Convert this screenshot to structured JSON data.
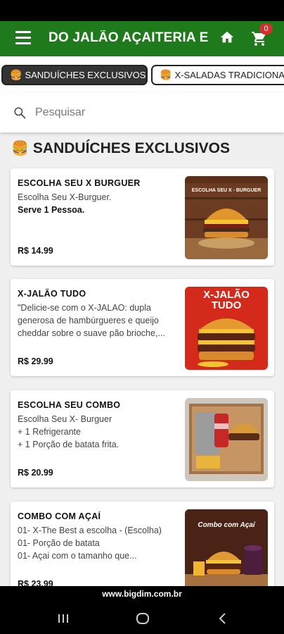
{
  "app_bar": {
    "title": "DO JALÃO AÇAITERIA E",
    "menu_icon": "menu-icon",
    "home_icon": "home-icon",
    "cart_icon": "cart-icon",
    "cart_count": "0",
    "color": "#1e7a1a"
  },
  "tabs": [
    {
      "icon": "🍔",
      "label": "SANDUÍCHES EXCLUSIVOS",
      "active": true
    },
    {
      "icon": "🍔",
      "label": "X-SALADAS TRADICIONAIS",
      "active": false
    }
  ],
  "search": {
    "placeholder": "Pesquisar",
    "value": ""
  },
  "section": {
    "emoji": "🍔",
    "title": "SANDUÍCHES EXCLUSIVOS"
  },
  "products": [
    {
      "title": "ESCOLHA SEU X BURGUER",
      "desc_lines": [
        "Escolha Seu X-Burguer."
      ],
      "bold_line": "Serve 1 Pessoa.",
      "price": "R$ 14.99",
      "image_label": "ESCOLHA SEU X - BURGUER"
    },
    {
      "title": "X-JALÃO TUDO",
      "desc_lines": [
        "\"Delicie-se com o X-JALAO: dupla",
        "generosa de hambúrgueres e queijo",
        "cheddar sobre o suave pão brioche,..."
      ],
      "price": "R$ 29.99",
      "image_label_line1": "X-JALÃO",
      "image_label_line2": "TUDO"
    },
    {
      "title": "ESCOLHA SEU COMBO",
      "desc_lines": [
        "Escolha Seu X- Burguer",
        "+ 1 Refrigerante",
        "+ 1 Porção de batata frita."
      ],
      "price": "R$ 20.99"
    },
    {
      "title": "COMBO COM AÇAÍ",
      "desc_lines": [
        "01- X-The Best a escolha - (Escolha)",
        "01- Porção de batata",
        "01- Açai com o tamanho que..."
      ],
      "price": "R$ 23.99",
      "image_label": "Combo com Açaí"
    }
  ],
  "footer": {
    "text": "www.bigdim.com.br"
  },
  "nav": {
    "recents_icon": "recents-icon",
    "home_icon": "circle-home-icon",
    "back_icon": "back-icon"
  }
}
